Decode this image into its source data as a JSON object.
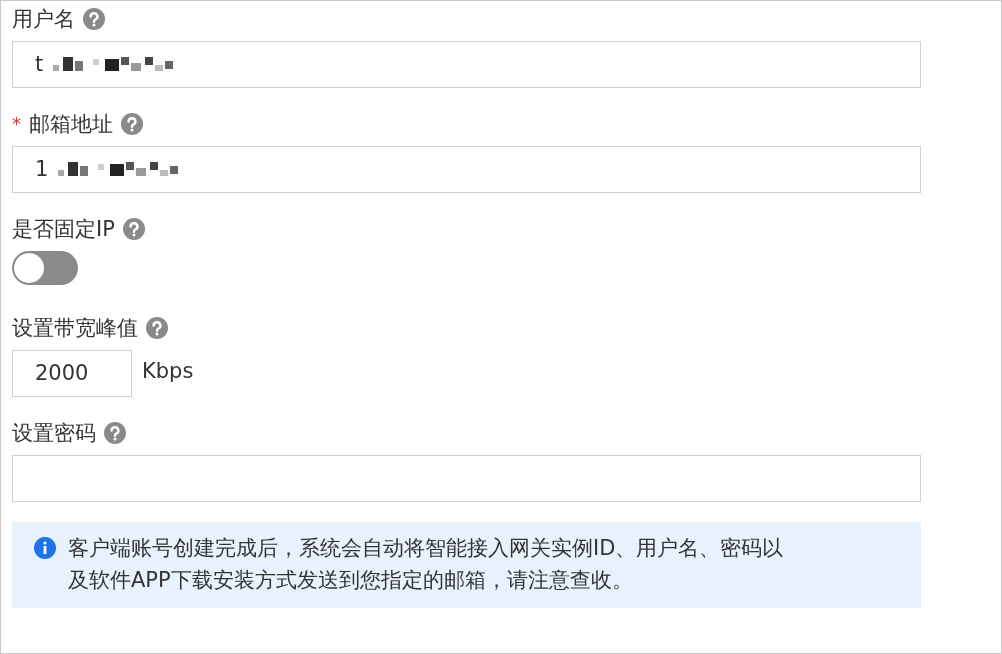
{
  "fields": [
    {
      "kind": "text",
      "label": "用户名",
      "value": "t",
      "redacted": true
    },
    {
      "kind": "text",
      "required_mark": "*",
      "label": "邮箱地址",
      "value": "1",
      "redacted": true
    },
    {
      "kind": "switch",
      "label": "是否固定IP",
      "on": false
    },
    {
      "kind": "number",
      "label": "设置带宽峰值",
      "value": "2000",
      "unit": "Kbps"
    },
    {
      "kind": "text",
      "label": "设置密码"
    }
  ],
  "notice": {
    "text": "客户端账号创建完成后，系统会自动将智能接入网关实例ID、用户名、密码以及软件APP下载安装方式发送到您指定的邮箱，请注意查收。"
  }
}
